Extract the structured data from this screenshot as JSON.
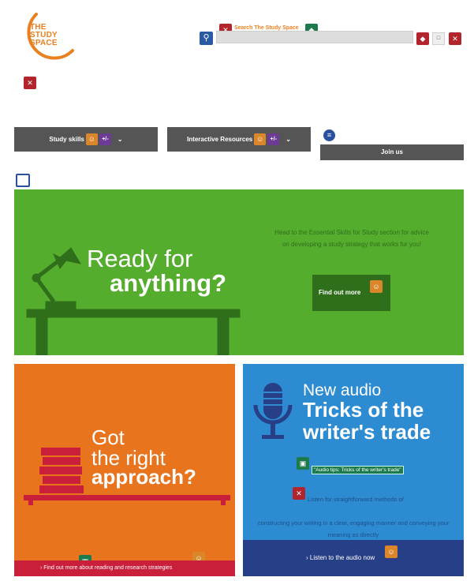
{
  "logo": {
    "line1": "THE",
    "line2": "STUDY",
    "line3": "SPACE"
  },
  "search": {
    "label": "Search The Study Space",
    "placeholder": "",
    "go_label": "□"
  },
  "nav": {
    "study_skills": "Study skills",
    "interactive_resources": "Interactive Resources",
    "chevron": "⌄",
    "join": "Join us"
  },
  "hero": {
    "line1": "Ready for",
    "line2": "anything?",
    "description": "Head to the Essential Skills for Study section for advice on developing a study strategy that works for you!",
    "button": "Find out more"
  },
  "orange_tile": {
    "line1": "Got",
    "line2": "the right",
    "line3": "approach?",
    "link": "› Find out more about reading and research strategies"
  },
  "blue_tile": {
    "line1": "New audio",
    "line2": "Tricks of the",
    "line3": "writer's trade",
    "audio_link": "\"Audio tips: Tricks of the writer's trade\"",
    "desc1": "Listen for straightforward methods of",
    "desc2": "constructing your writing in a clear, engaging manner and conveying your meaning as directly",
    "bar": "› Listen to the audio now"
  },
  "icons": {
    "search": "magnifier",
    "error_badge": "red-error",
    "tag_badge": "green-tag",
    "nav_badge1": "orange-a11y",
    "nav_badge2": "purple-math",
    "list": "list-circle",
    "bin": "trash-outline"
  },
  "colors": {
    "brand_orange": "#e8801f",
    "hero_green": "#55ad2e",
    "hero_dark_green": "#2f6e1b",
    "orange_tile": "#e8741e",
    "crimson": "#c91f3a",
    "blue_tile": "#2d8bd2",
    "navy": "#263f86",
    "nav_grey": "#555555"
  }
}
